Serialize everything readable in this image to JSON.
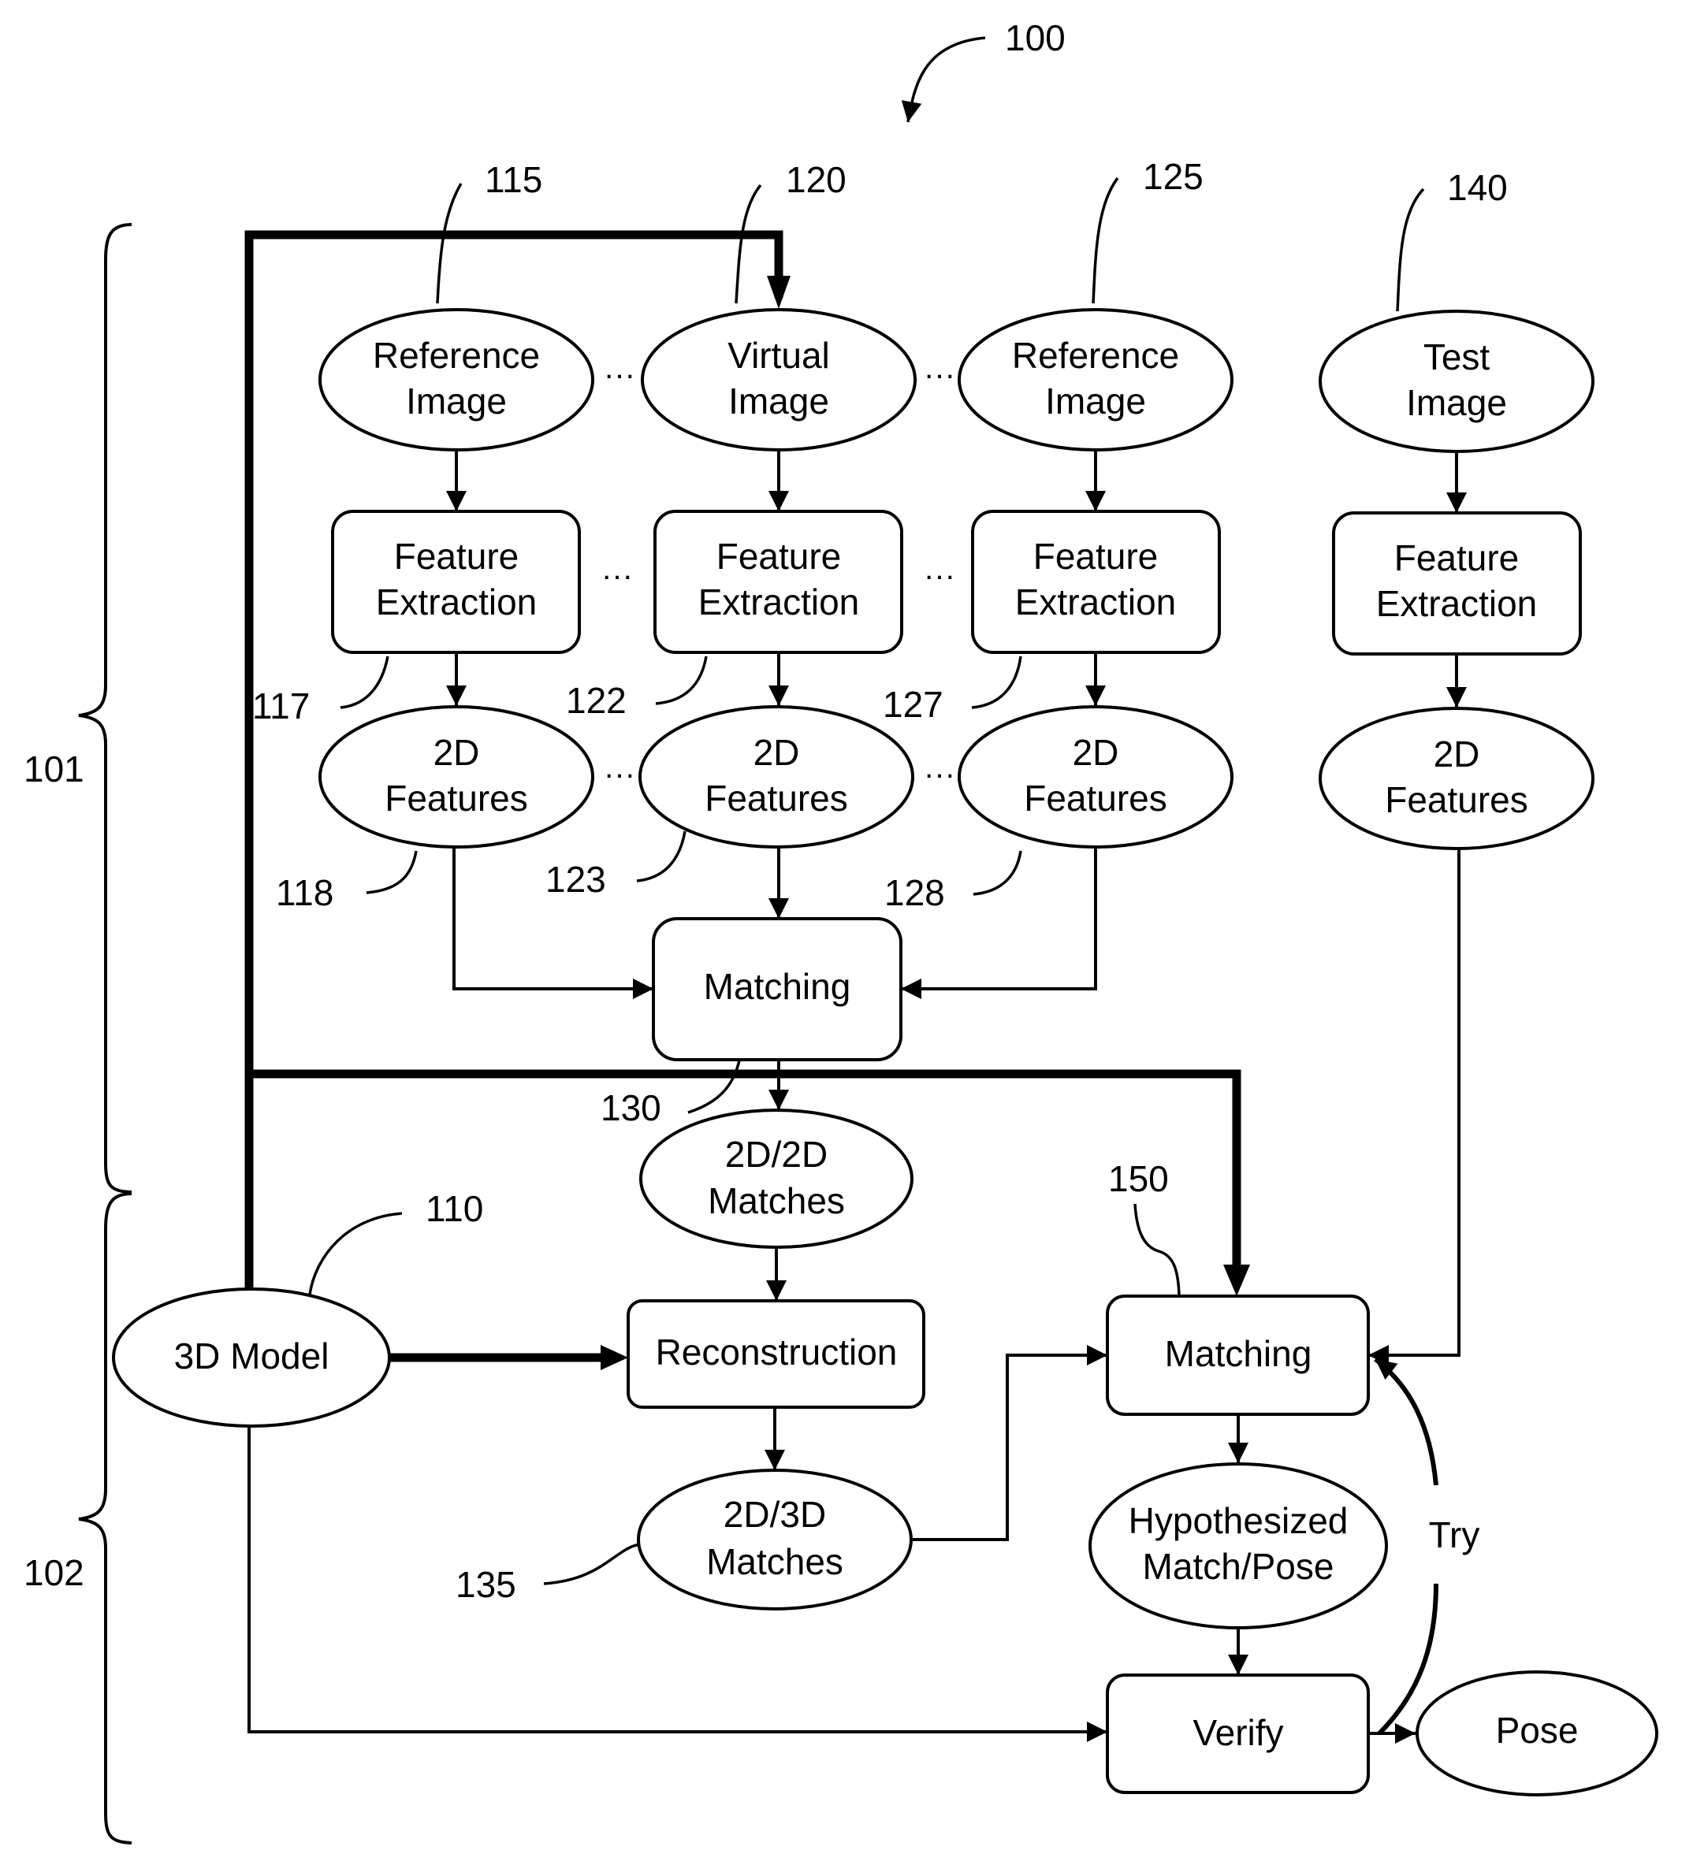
{
  "figure": {
    "reference": "100",
    "groups": [
      {
        "id": "101",
        "label": "101"
      },
      {
        "id": "102",
        "label": "102"
      }
    ]
  },
  "nodes": {
    "ref_image_1": {
      "ref": "115",
      "lines": [
        "Reference",
        "Image"
      ]
    },
    "virtual_image": {
      "ref": "120",
      "lines": [
        "Virtual",
        "Image"
      ]
    },
    "ref_image_2": {
      "ref": "125",
      "lines": [
        "Reference",
        "Image"
      ]
    },
    "test_image": {
      "ref": "140",
      "lines": [
        "Test",
        "Image"
      ]
    },
    "fe_1": {
      "ref": "117",
      "lines": [
        "Feature",
        "Extraction"
      ]
    },
    "fe_2": {
      "ref": "122",
      "lines": [
        "Feature",
        "Extraction"
      ]
    },
    "fe_3": {
      "ref": "127",
      "lines": [
        "Feature",
        "Extraction"
      ]
    },
    "fe_4": {
      "lines": [
        "Feature",
        "Extraction"
      ]
    },
    "features_1": {
      "ref": "118",
      "lines": [
        "2D",
        "Features"
      ]
    },
    "features_2": {
      "ref": "123",
      "lines": [
        "2D",
        "Features"
      ]
    },
    "features_3": {
      "ref": "128",
      "lines": [
        "2D",
        "Features"
      ]
    },
    "features_4": {
      "lines": [
        "2D",
        "Features"
      ]
    },
    "matching_1": {
      "ref": "130",
      "lines": [
        "Matching"
      ]
    },
    "matches_2d2d": {
      "lines": [
        "2D/2D",
        "Matches"
      ]
    },
    "model_3d": {
      "ref": "110",
      "lines": [
        "3D Model"
      ]
    },
    "reconstruction": {
      "lines": [
        "Reconstruction"
      ]
    },
    "matches_2d3d": {
      "ref": "135",
      "lines": [
        "2D/3D",
        "Matches"
      ]
    },
    "matching_2": {
      "ref": "150",
      "lines": [
        "Matching"
      ]
    },
    "hypothesized": {
      "lines": [
        "Hypothesized",
        "Match/Pose"
      ]
    },
    "verify": {
      "lines": [
        "Verify"
      ]
    },
    "pose": {
      "lines": [
        "Pose"
      ]
    }
  },
  "edge_labels": {
    "try": "Try"
  },
  "ellipsis": "···"
}
